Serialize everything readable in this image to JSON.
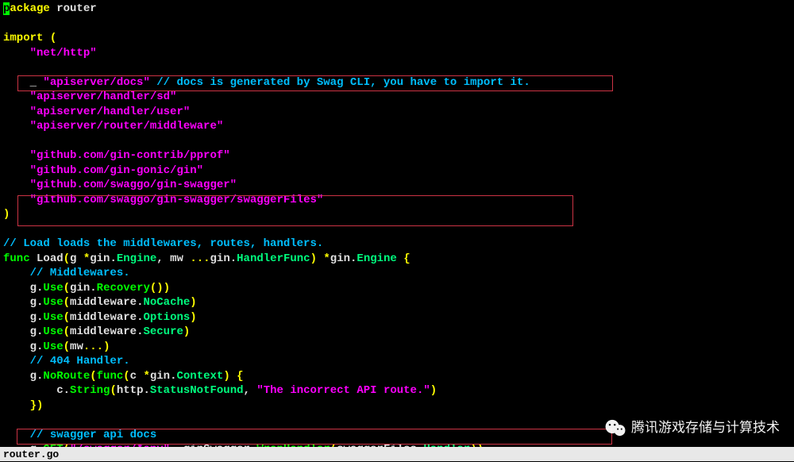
{
  "cursor_char": "p",
  "line1_rest": "ackage",
  "pkg_name": " router",
  "kw_import": "import",
  "paren_open": " (",
  "import_nethttp": "\"net/http\"",
  "import_docs_underscore": "_ ",
  "import_docs": "\"apiserver/docs\"",
  "import_docs_comment": " // docs is generated by Swag CLI, you have to import it.",
  "import_sd": "\"apiserver/handler/sd\"",
  "import_user": "\"apiserver/handler/user\"",
  "import_middleware": "\"apiserver/router/middleware\"",
  "import_pprof": "\"github.com/gin-contrib/pprof\"",
  "import_gin": "\"github.com/gin-gonic/gin\"",
  "import_swagger": "\"github.com/swaggo/gin-swagger\"",
  "import_swaggerfiles": "\"github.com/swaggo/gin-swagger/swaggerFiles\"",
  "paren_close": ")",
  "comment_load": "// Load loads the middlewares, routes, handlers.",
  "kw_func": "func",
  "func_name": " Load",
  "func_sig_open": "(",
  "param_g": "g ",
  "star": "*",
  "gin_pkg": "gin",
  "engine_type": "Engine",
  "param_mw": ", mw ",
  "ellipsis": "...",
  "handlerfunc": "HandlerFunc",
  "func_sig_close": ")",
  "ret_sp": " ",
  "brace_open": " {",
  "comment_mw": "// Middlewares.",
  "g_var": "g",
  "use_method": "Use",
  "recovery_call": "Recovery",
  "mw_pkg": "middleware",
  "nocache": "NoCache",
  "options": "Options",
  "secure": "Secure",
  "mw_var": "mw",
  "comment_404": "// 404 Handler.",
  "noroute": "NoRoute",
  "func_kw_inline": "func",
  "c_param": "c ",
  "context_type": "Context",
  "c_var": "c",
  "string_method": "String",
  "http_pkg": "http",
  "statusnf": "StatusNotFound",
  "route_msg": "\"The incorrect API route.\"",
  "brace_close": "}",
  "close_paren_brace": "})",
  "comment_swagger": "// swagger api docs",
  "get_method": "GET",
  "swagger_route": "\"/swagger/*any\"",
  "ginswagger_pkg": "ginSwagger",
  "wraphandler": "WrapHandler",
  "swaggerfiles_pkg": "swaggerFiles",
  "handler_ident": "Handler",
  "status_file": "router.go",
  "watermark_text": "腾讯游戏存储与计算技术",
  "indent1": "    ",
  "indent2": "        "
}
